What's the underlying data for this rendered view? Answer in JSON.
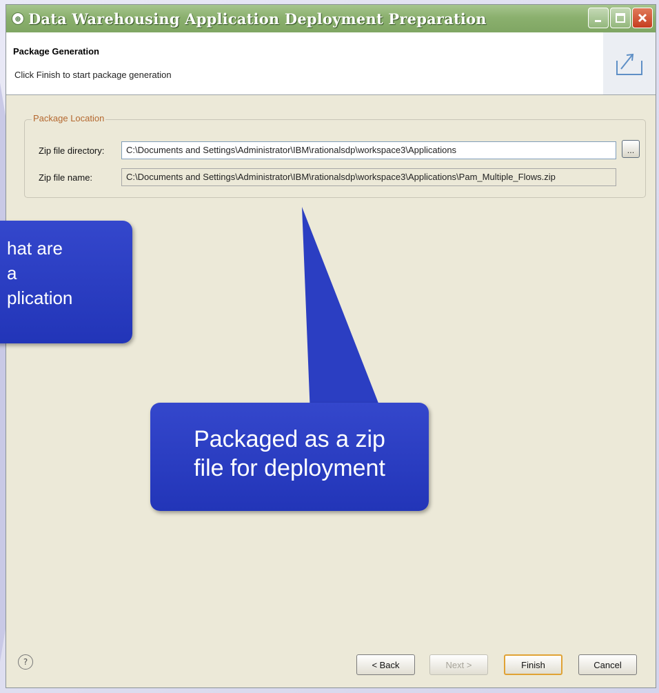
{
  "window": {
    "title": "Data Warehousing Application Deployment Preparation",
    "title_color": "#7fa663",
    "background": "#ece9d8"
  },
  "header": {
    "title": "Package Generation",
    "description": "Click Finish to start package generation",
    "icon": "export-icon"
  },
  "package_location": {
    "group_label": "Package Location",
    "zip_dir_label": "Zip file directory:",
    "zip_dir_value": "C:\\Documents and Settings\\Administrator\\IBM\\rationalsdp\\workspace3\\Applications",
    "zip_name_label": "Zip file name:",
    "zip_name_value": "C:\\Documents and Settings\\Administrator\\IBM\\rationalsdp\\workspace3\\Applications\\Pam_Multiple_Flows.zip",
    "browse_label": "..."
  },
  "callouts": {
    "left_lines": [
      "hat are",
      "a",
      "plication"
    ],
    "main_line1": "Packaged as a zip",
    "main_line2": "file for deployment",
    "color": "#2a3dc0"
  },
  "buttons": {
    "help": "?",
    "back": "< Back",
    "next": "Next >",
    "finish": "Finish",
    "cancel": "Cancel"
  }
}
